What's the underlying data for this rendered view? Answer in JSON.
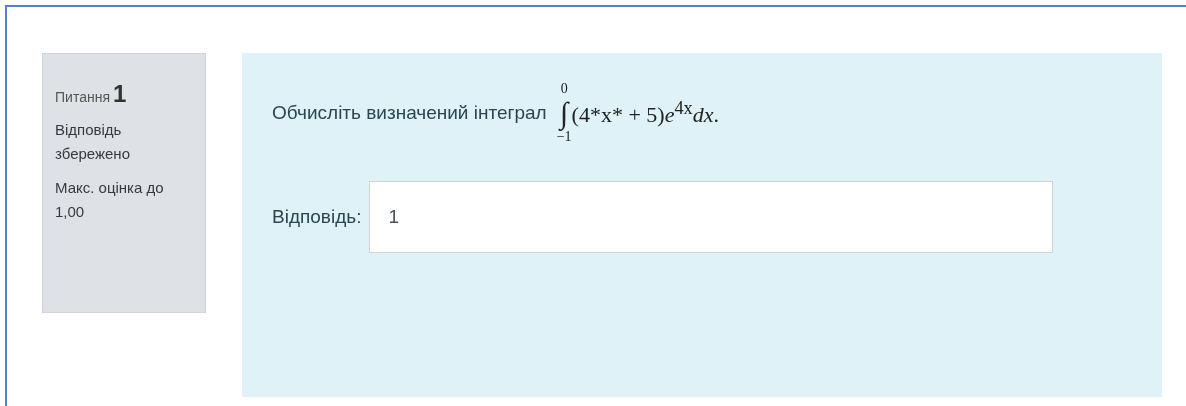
{
  "info": {
    "label": "Питання",
    "number": "1",
    "state": "Відповідь збережено",
    "grade": "Макс. оцінка до 1,00"
  },
  "question": {
    "text": "Обчисліть визначений інтеграл",
    "integral": {
      "sign": "∫",
      "upper": "0",
      "lower": "−1",
      "integrand": "(4*x* + 5)*e*$^{4x}$*dx*."
    }
  },
  "answer": {
    "label": "Відповідь:",
    "value": "1"
  }
}
